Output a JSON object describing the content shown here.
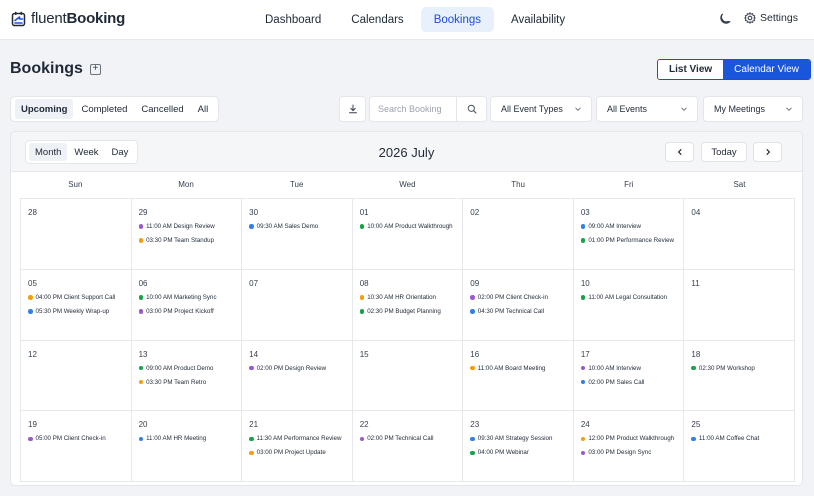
{
  "brand": {
    "part1": "fluent",
    "part2": "Booking"
  },
  "nav": {
    "tabs": [
      {
        "label": "Dashboard",
        "active": false
      },
      {
        "label": "Calendars",
        "active": false
      },
      {
        "label": "Bookings",
        "active": true
      },
      {
        "label": "Availability",
        "active": false
      }
    ],
    "settings_label": "Settings"
  },
  "page": {
    "title": "Bookings",
    "view_list": "List View",
    "view_calendar": "Calendar View",
    "active_view": "Calendar View"
  },
  "filters": {
    "status_tabs": [
      {
        "label": "Upcoming",
        "active": true
      },
      {
        "label": "Completed",
        "active": false
      },
      {
        "label": "Cancelled",
        "active": false
      },
      {
        "label": "All",
        "active": false
      }
    ],
    "search_placeholder": "Search Booking",
    "event_types": "All Event Types",
    "events": "All Events",
    "meetings": "My Meetings"
  },
  "calendar": {
    "modes": [
      {
        "label": "Month",
        "active": true
      },
      {
        "label": "Week",
        "active": false
      },
      {
        "label": "Day",
        "active": false
      }
    ],
    "title": "2026 July",
    "today_label": "Today",
    "weekdays": [
      "Sun",
      "Mon",
      "Tue",
      "Wed",
      "Thu",
      "Fri",
      "Sat"
    ],
    "colors": {
      "purple": "#9b59d0",
      "orange": "#f59e0b",
      "blue": "#2f80ed",
      "green": "#16a34a"
    },
    "weeks": [
      [
        {
          "day": "28",
          "events": []
        },
        {
          "day": "29",
          "events": [
            {
              "text": "11:00 AM Design Review",
              "color": "purple"
            },
            {
              "text": "03:30 PM Team Standup",
              "color": "orange"
            }
          ]
        },
        {
          "day": "30",
          "events": [
            {
              "text": "09:30 AM Sales Demo",
              "color": "blue"
            }
          ]
        },
        {
          "day": "01",
          "events": [
            {
              "text": "10:00 AM Product Walkthrough",
              "color": "green"
            }
          ]
        },
        {
          "day": "02",
          "events": []
        },
        {
          "day": "03",
          "events": [
            {
              "text": "09:00 AM Interview",
              "color": "blue"
            },
            {
              "text": "01:00 PM Performance Review",
              "color": "green"
            }
          ]
        },
        {
          "day": "04",
          "events": []
        }
      ],
      [
        {
          "day": "05",
          "events": [
            {
              "text": "04:00 PM Client Support Call",
              "color": "orange"
            },
            {
              "text": "05:30 PM Weekly Wrap-up",
              "color": "blue"
            }
          ]
        },
        {
          "day": "06",
          "events": [
            {
              "text": "10:00 AM Marketing Sync",
              "color": "green"
            },
            {
              "text": "03:00 PM Project Kickoff",
              "color": "purple"
            }
          ]
        },
        {
          "day": "07",
          "events": []
        },
        {
          "day": "08",
          "events": [
            {
              "text": "10:30 AM HR Orientation",
              "color": "orange"
            },
            {
              "text": "02:30 PM Budget Planning",
              "color": "green"
            }
          ]
        },
        {
          "day": "09",
          "events": [
            {
              "text": "02:00 PM Client Check-in",
              "color": "purple"
            },
            {
              "text": "04:30 PM Technical Call",
              "color": "blue"
            }
          ]
        },
        {
          "day": "10",
          "events": [
            {
              "text": "11:00 AM Legal Consultation",
              "color": "green"
            }
          ]
        },
        {
          "day": "11",
          "events": []
        }
      ],
      [
        {
          "day": "12",
          "events": []
        },
        {
          "day": "13",
          "events": [
            {
              "text": "09:00 AM Product Demo",
              "color": "green"
            },
            {
              "text": "03:30 PM Team Retro",
              "color": "orange"
            }
          ]
        },
        {
          "day": "14",
          "events": [
            {
              "text": "02:00 PM Design Review",
              "color": "purple"
            }
          ]
        },
        {
          "day": "15",
          "events": []
        },
        {
          "day": "16",
          "events": [
            {
              "text": "11:00 AM Board Meeting",
              "color": "orange"
            }
          ]
        },
        {
          "day": "17",
          "events": [
            {
              "text": "10:00 AM Interview",
              "color": "purple"
            },
            {
              "text": "02:00 PM Sales Call",
              "color": "blue"
            }
          ]
        },
        {
          "day": "18",
          "events": [
            {
              "text": "02:30 PM Workshop",
              "color": "green"
            }
          ]
        }
      ],
      [
        {
          "day": "19",
          "events": [
            {
              "text": "05:00 PM Client Check-in",
              "color": "purple"
            }
          ]
        },
        {
          "day": "20",
          "events": [
            {
              "text": "11:00 AM HR Meeting",
              "color": "blue"
            }
          ]
        },
        {
          "day": "21",
          "events": [
            {
              "text": "11:30 AM Performance Review",
              "color": "green"
            },
            {
              "text": "03:00 PM Project Update",
              "color": "orange"
            }
          ]
        },
        {
          "day": "22",
          "events": [
            {
              "text": "02:00 PM Technical Call",
              "color": "purple"
            }
          ]
        },
        {
          "day": "23",
          "events": [
            {
              "text": "09:30 AM Strategy Session",
              "color": "blue"
            },
            {
              "text": "04:00 PM Webinar",
              "color": "green"
            }
          ]
        },
        {
          "day": "24",
          "events": [
            {
              "text": "12:00 PM Product Walkthrough",
              "color": "orange"
            },
            {
              "text": "03:00 PM Design Sync",
              "color": "purple"
            }
          ]
        },
        {
          "day": "25",
          "events": [
            {
              "text": "11:00 AM Coffee Chat",
              "color": "blue"
            }
          ]
        }
      ]
    ]
  }
}
